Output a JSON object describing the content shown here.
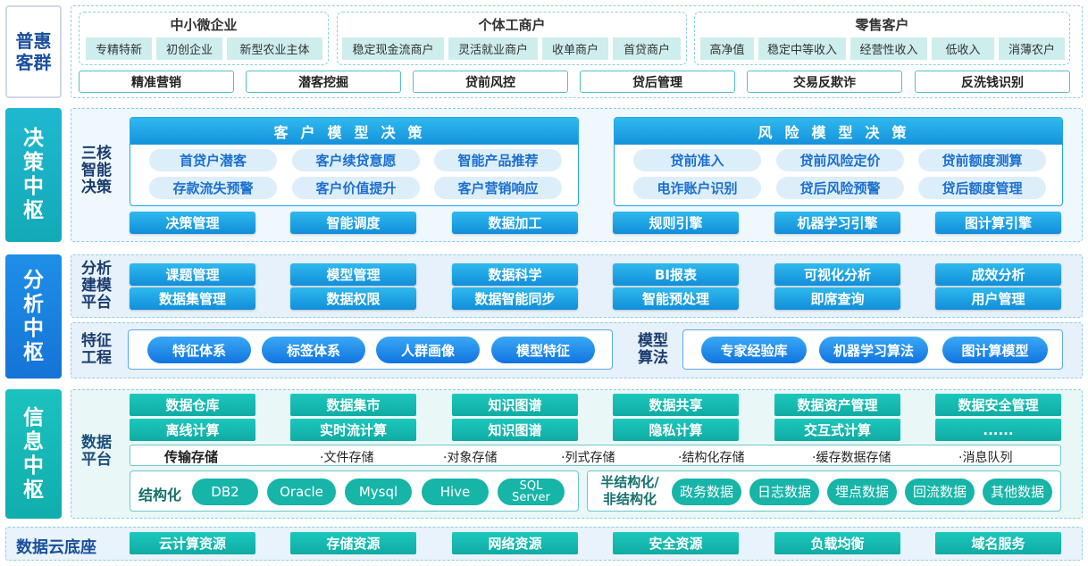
{
  "colors": {
    "blue_label": "#1a7fd6",
    "teal_label": "#13b5ad",
    "accent_blue": "#1592db",
    "accent_teal": "#10aba4"
  },
  "customers": {
    "label": "普惠客群",
    "groups": [
      {
        "title": "中小微企业",
        "items": [
          "专精特新",
          "初创企业",
          "新型农业主体"
        ]
      },
      {
        "title": "个体工商户",
        "items": [
          "稳定现金流商户",
          "灵活就业商户",
          "收单商户",
          "首贷商户"
        ]
      },
      {
        "title": "零售客户",
        "items": [
          "高净值",
          "稳定中等收入",
          "经营性收入",
          "低收入",
          "消薄农户"
        ]
      }
    ],
    "scenarios": [
      "精准营销",
      "潜客挖掘",
      "贷前风控",
      "贷后管理",
      "交易反欺诈",
      "反洗钱识别"
    ]
  },
  "decision": {
    "label": "决策中枢",
    "sub_label": "三核智能决策",
    "customer_model": {
      "title": "客户模型决策",
      "items": [
        "首贷户潜客",
        "客户续贷意愿",
        "智能产品推荐",
        "存款流失预警",
        "客户价值提升",
        "客户营销响应"
      ]
    },
    "risk_model": {
      "title": "风险模型决策",
      "items": [
        "贷前准入",
        "贷前风险定价",
        "贷前额度测算",
        "电诈账户识别",
        "贷后风险预警",
        "贷后额度管理"
      ]
    },
    "engines": [
      "决策管理",
      "智能调度",
      "数据加工",
      "规则引擎",
      "机器学习引擎",
      "图计算引擎"
    ]
  },
  "analysis": {
    "label": "分析中枢",
    "platform_label": "分析建模平台",
    "platform_items": [
      "课题管理",
      "模型管理",
      "数据科学",
      "BI报表",
      "可视化分析",
      "成效分析",
      "数据集管理",
      "数据权限",
      "数据智能同步",
      "智能预处理",
      "即席查询",
      "用户管理"
    ],
    "feature_label": "特征工程",
    "feature_items": [
      "特征体系",
      "标签体系",
      "人群画像",
      "模型特征"
    ],
    "algo_label": "模型算法",
    "algo_items": [
      "专家经验库",
      "机器学习算法",
      "图计算模型"
    ]
  },
  "info": {
    "label": "信息中枢",
    "platform_label": "数据平台",
    "row1": [
      "数据仓库",
      "数据集市",
      "知识图谱",
      "数据共享",
      "数据资产管理",
      "数据安全管理"
    ],
    "row2": [
      "离线计算",
      "实时流计算",
      "知识图谱",
      "隐私计算",
      "交互式计算",
      "......"
    ],
    "storage_label": "传输存储",
    "storage_items": [
      "·文件存储",
      "·对象存储",
      "·列式存储",
      "·结构化存储",
      "·缓存数据存储",
      "·消息队列"
    ],
    "structured_label": "结构化",
    "structured_items": [
      "DB2",
      "Oracle",
      "Mysql",
      "Hive",
      "SQL Server"
    ],
    "semi_label": "半结构化/非结构化",
    "semi_items": [
      "政务数据",
      "日志数据",
      "埋点数据",
      "回流数据",
      "其他数据"
    ]
  },
  "cloud": {
    "label": "数据云底座",
    "items": [
      "云计算资源",
      "存储资源",
      "网络资源",
      "安全资源",
      "负载均衡",
      "域名服务"
    ]
  }
}
